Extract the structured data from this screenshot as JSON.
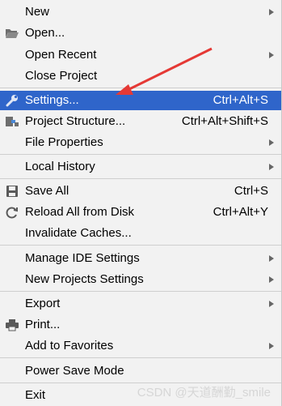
{
  "menu": {
    "new": "New",
    "open": "Open...",
    "open_recent": "Open Recent",
    "close_project": "Close Project",
    "settings": "Settings...",
    "settings_shortcut": "Ctrl+Alt+S",
    "project_structure": "Project Structure...",
    "project_structure_shortcut": "Ctrl+Alt+Shift+S",
    "file_properties": "File Properties",
    "local_history": "Local History",
    "save_all": "Save All",
    "save_all_shortcut": "Ctrl+S",
    "reload": "Reload All from Disk",
    "reload_shortcut": "Ctrl+Alt+Y",
    "invalidate": "Invalidate Caches...",
    "manage_ide": "Manage IDE Settings",
    "new_projects_settings": "New Projects Settings",
    "export": "Export",
    "print": "Print...",
    "add_favorites": "Add to Favorites",
    "power_save": "Power Save Mode",
    "exit": "Exit"
  },
  "watermark": "CSDN @天道酬勤_smile",
  "colors": {
    "selection": "#2f65ca",
    "background": "#f2f2f2",
    "annotation": "#e53935"
  }
}
